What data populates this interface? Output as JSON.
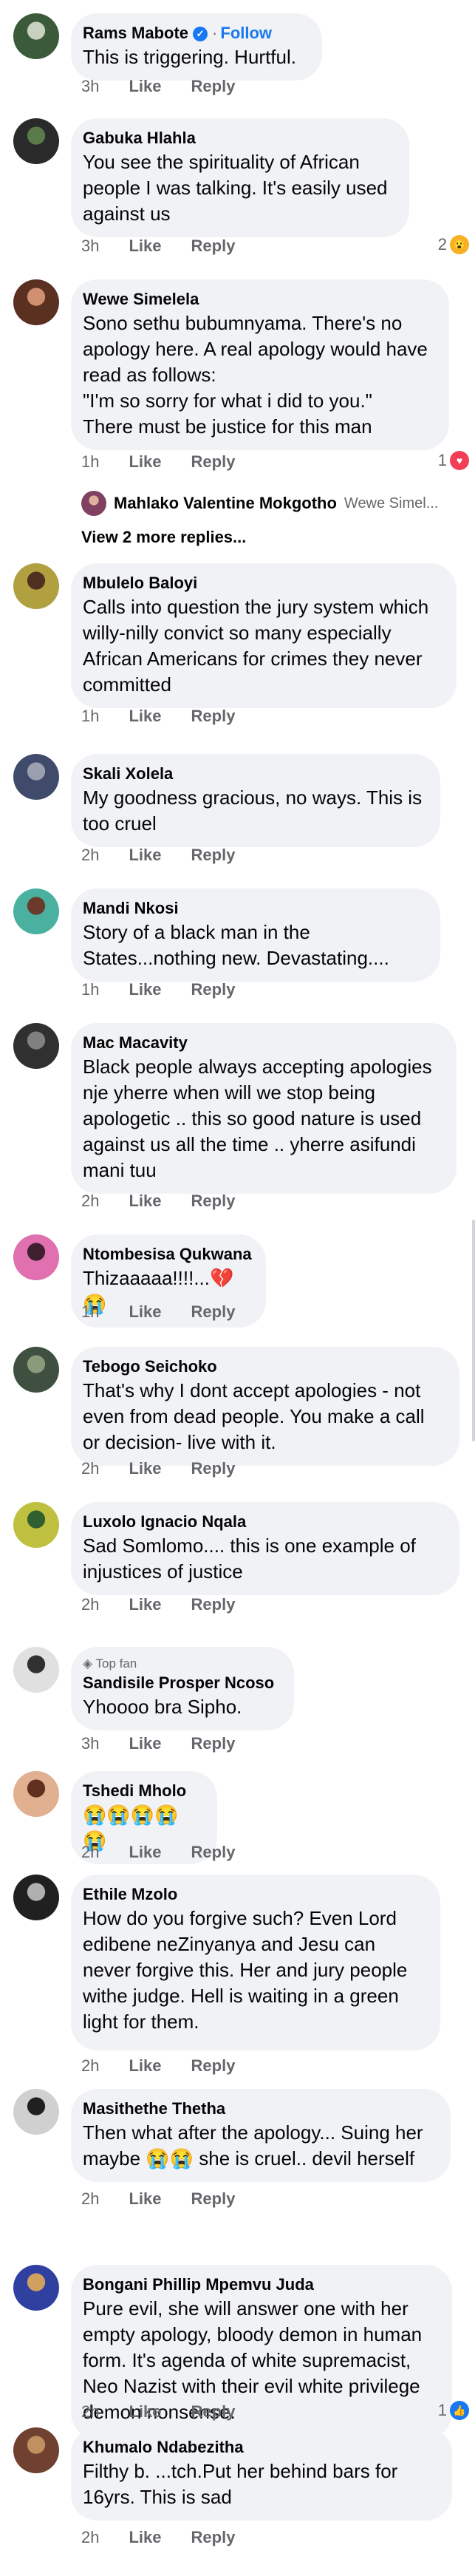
{
  "icons": {
    "verified": "verified-badge-icon",
    "topfan": "diamond-icon"
  },
  "comments": [
    {
      "name": "Rams Mabote",
      "verified": true,
      "follow": "Follow",
      "text": "This is triggering. Hurtful.",
      "time": "3h",
      "like": "Like",
      "reply": "Reply",
      "av": [
        "#3a5a3a",
        "#c8d0c0"
      ]
    },
    {
      "name": "Gabuka Hlahla",
      "text": "You see the spirituality of African people I was talking.  It's easily used against us",
      "time": "3h",
      "like": "Like",
      "reply": "Reply",
      "reactions": {
        "count": "2",
        "emoji": "😮"
      },
      "av": [
        "#2a2a2a",
        "#5a7a4a"
      ]
    },
    {
      "name": "Wewe Simelela",
      "text": "Sono sethu bubumnyama. There's no apology here. A real apology would have read as follows:\n\"I'm so sorry for what i did to you.\"\nThere must be justice for this man",
      "time": "1h",
      "like": "Like",
      "reply": "Reply",
      "reactions": {
        "count": "1",
        "emoji": "♥"
      },
      "av": [
        "#5a3020",
        "#d09070"
      ]
    },
    {
      "name": "Mbulelo Baloyi",
      "text": "Calls into question the jury system which willy-nilly convict so many especially African Americans for crimes they never committed",
      "time": "1h",
      "like": "Like",
      "reply": "Reply",
      "av": [
        "#b0a040",
        "#503020"
      ]
    },
    {
      "name": "Skali Xolela",
      "text": "My goodness gracious,  no ways.  This is too cruel",
      "time": "2h",
      "like": "Like",
      "reply": "Reply",
      "av": [
        "#404a6a",
        "#9aa0b0"
      ]
    },
    {
      "name": "Mandi Nkosi",
      "text": "Story of a black man in the States...nothing new. Devastating....",
      "time": "1h",
      "like": "Like",
      "reply": "Reply",
      "av": [
        "#4ab0a0",
        "#6a3a2a"
      ]
    },
    {
      "name": "Mac Macavity",
      "text": "Black people  always accepting apologies  nje yherre  when will we stop being apologetic  .. this so good nature is used against us all the time .. yherre asifundi  mani  tuu",
      "time": "2h",
      "like": "Like",
      "reply": "Reply",
      "av": [
        "#303030",
        "#808080"
      ]
    },
    {
      "name": "Ntombesisa Qukwana",
      "text": "Thizaaaaa!!!!...💔😭",
      "time": "1h",
      "like": "Like",
      "reply": "Reply",
      "av": [
        "#e070b0",
        "#402030"
      ]
    },
    {
      "name": "Tebogo Seichoko",
      "text": "That's why I dont accept apologies - not even from dead people. You make a call or decision- live with it.",
      "time": "2h",
      "like": "Like",
      "reply": "Reply",
      "av": [
        "#405040",
        "#8a9a7a"
      ]
    },
    {
      "name": "Luxolo Ignacio Nqala",
      "text": "Sad Somlomo.... this is one example of injustices of justice",
      "time": "2h",
      "like": "Like",
      "reply": "Reply",
      "av": [
        "#c0c040",
        "#306030"
      ]
    },
    {
      "name": "Sandisile Prosper Ncoso",
      "topfan": "Top fan",
      "text": "Yhoooo bra Sipho.",
      "time": "3h",
      "like": "Like",
      "reply": "Reply",
      "av": [
        "#e0e0e0",
        "#303030"
      ]
    },
    {
      "name": "Tshedi Mholo",
      "text": "😭😭😭😭😭",
      "time": "2h",
      "like": "Like",
      "reply": "Reply",
      "av": [
        "#e0b090",
        "#603020"
      ]
    },
    {
      "name": "Ethile Mzolo",
      "text": "How do you forgive such? Even Lord edibene neZinyanya and Jesu can never forgive this. Her and jury people withe judge. Hell is waiting in a green light for them.",
      "time": "2h",
      "like": "Like",
      "reply": "Reply",
      "av": [
        "#202020",
        "#b0b0b0"
      ]
    },
    {
      "name": "Masithethe Thetha",
      "text": "Then what after the apology... Suing her maybe 😭😭 she is cruel.. devil herself",
      "time": "2h",
      "like": "Like",
      "reply": "Reply",
      "av": [
        "#d0d0d0",
        "#202020"
      ]
    },
    {
      "name": "Bongani Phillip Mpemvu Juda",
      "text": "Pure evil, she will answer one with her empty apology, bloody demon in human form. It's agenda of white supremacist, Neo Nazist with their evil white privilege demon nonsense.",
      "time": "2h",
      "like": "Like",
      "reply": "Reply",
      "reactions": {
        "count": "1",
        "emoji": "👍"
      },
      "av": [
        "#3040a0",
        "#d0a060"
      ]
    },
    {
      "name": "Khumalo Ndabezitha",
      "text": "Filthy b. ...tch.Put her behind bars for 16yrs. This is sad",
      "time": "2h",
      "like": "Like",
      "reply": "Reply",
      "av": [
        "#704030",
        "#c09060"
      ]
    }
  ],
  "reply_preview": {
    "name": "Mahlako Valentine Mokgotho",
    "text": "Wewe Simel...",
    "view_more": "View 2 more replies..."
  }
}
